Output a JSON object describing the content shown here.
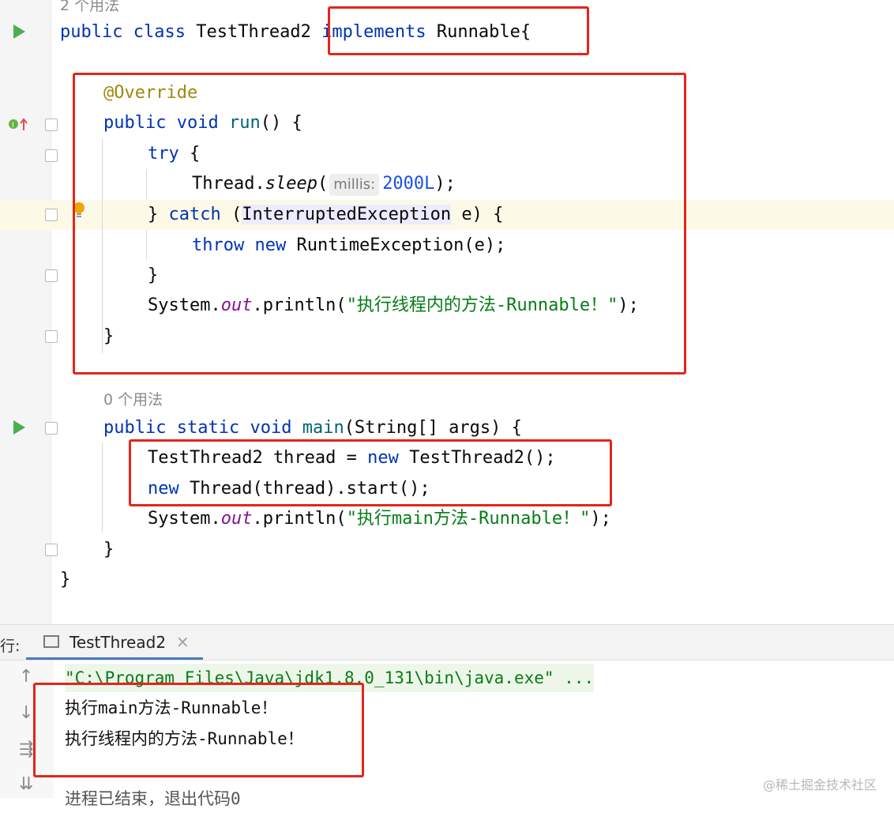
{
  "editor": {
    "usage_top": "2 个用法",
    "line1": {
      "kw1": "public",
      "kw2": "class",
      "name": "TestThread2",
      "kw3": "implements",
      "iface": "Runnable{"
    },
    "line2": {
      "annotation": "@Override"
    },
    "line3": {
      "kw1": "public",
      "kw2": "void",
      "fn": "run",
      "rest": "() {"
    },
    "line4": {
      "kw": "try",
      "rest": " {"
    },
    "line5": {
      "pre": "Thread.",
      "method": "sleep",
      "open": "(",
      "hint": "millis:",
      "num": "2000L",
      "close": ");"
    },
    "line6": {
      "pre": "} ",
      "kw": "catch",
      "open": " (",
      "type": "InterruptedException",
      "rest": " e) {"
    },
    "line7": {
      "kw1": "throw",
      "kw2": "new",
      "rest": " RuntimeException(e);"
    },
    "line8": {
      "text": "}"
    },
    "line9": {
      "pre": "System.",
      "field": "out",
      "mid": ".println(",
      "str": "\"执行线程内的方法-Runnable！\"",
      "close": ");"
    },
    "line10": {
      "text": "}"
    },
    "usage_main": "0 个用法",
    "line11": {
      "kw1": "public",
      "kw2": "static",
      "kw3": "void",
      "fn": "main",
      "rest": "(String[] args) {"
    },
    "line12": {
      "pre": "TestThread2 thread = ",
      "kw": "new",
      "rest": " TestThread2();"
    },
    "line13": {
      "kw": "new",
      "rest": " Thread(thread).start();"
    },
    "line14": {
      "pre": "System.",
      "field": "out",
      "mid": ".println(",
      "str": "\"执行main方法-Runnable！\"",
      "close": ");"
    },
    "line15": {
      "text": "}"
    },
    "line16": {
      "text": "}"
    }
  },
  "run_panel": {
    "label": "行:",
    "tab_label": "TestThread2",
    "tab_close": "×",
    "command": "\"C:\\Program Files\\Java\\jdk1.8.0_131\\bin\\java.exe\" ...",
    "output": [
      "执行main方法-Runnable！",
      "执行线程内的方法-Runnable！"
    ],
    "exit_line": "进程已结束，退出代码0"
  },
  "watermark": "@稀土掘金技术社区",
  "colors": {
    "keyword": "#0033b3",
    "string": "#067d17",
    "number": "#1750eb",
    "annotation": "#9e880d",
    "highlight_box": "#e1261c"
  }
}
